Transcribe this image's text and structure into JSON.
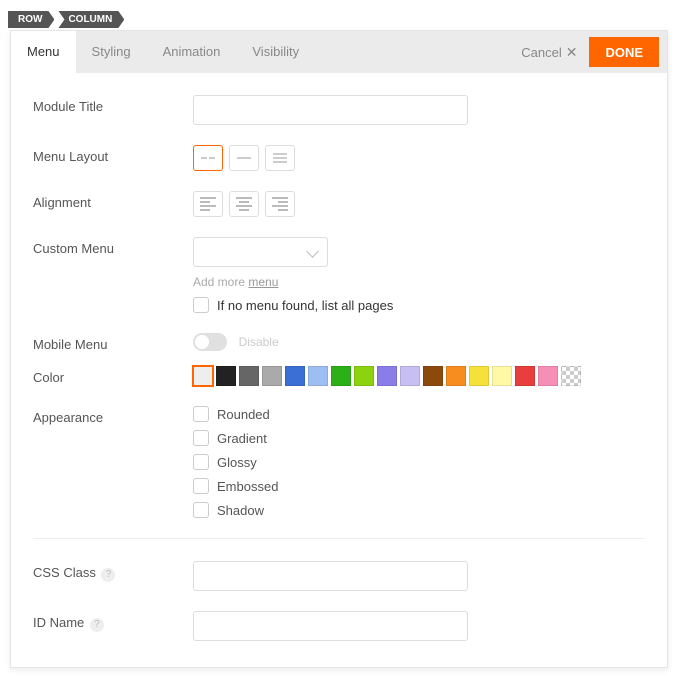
{
  "breadcrumb": {
    "row": "ROW",
    "column": "COLUMN"
  },
  "tabs": {
    "menu": "Menu",
    "styling": "Styling",
    "animation": "Animation",
    "visibility": "Visibility"
  },
  "actions": {
    "cancel": "Cancel",
    "done": "DONE"
  },
  "labels": {
    "module_title": "Module Title",
    "menu_layout": "Menu Layout",
    "alignment": "Alignment",
    "custom_menu": "Custom Menu",
    "mobile_menu": "Mobile Menu",
    "color": "Color",
    "appearance": "Appearance",
    "css_class": "CSS Class",
    "id_name": "ID Name"
  },
  "help_mark": "?",
  "custom_menu_hint_prefix": "Add more ",
  "custom_menu_hint_link": "menu",
  "custom_menu_fallback": "If no menu found, list all pages",
  "mobile_menu_toggle": "Disable",
  "colors": [
    "#eeeeee",
    "#222222",
    "#666666",
    "#aaaaaa",
    "#3b6fd6",
    "#9dbef2",
    "#2db017",
    "#8cd211",
    "#8b7de8",
    "#c7bff2",
    "#8b4a0b",
    "#f78c1f",
    "#f6e03a",
    "#fff9a6",
    "#e83e3e",
    "#f58fb7"
  ],
  "appearance": {
    "rounded": "Rounded",
    "gradient": "Gradient",
    "glossy": "Glossy",
    "embossed": "Embossed",
    "shadow": "Shadow"
  },
  "values": {
    "module_title": "",
    "custom_menu": "",
    "css_class": "",
    "id_name": ""
  }
}
